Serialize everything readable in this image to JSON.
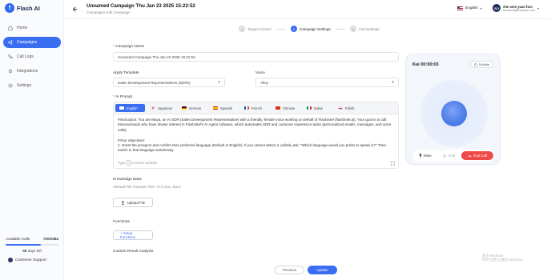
{
  "app": {
    "logo_text": "Flash AI",
    "logo_mark": "f"
  },
  "sidebar": {
    "items": [
      {
        "label": "Home",
        "icon": "home-icon",
        "active": false
      },
      {
        "label": "Campaigns",
        "icon": "megaphone-icon",
        "active": true
      },
      {
        "label": "Call Logs",
        "icon": "phone-icon",
        "active": false
      },
      {
        "label": "Integrations",
        "icon": "plug-icon",
        "active": false
      },
      {
        "label": "Settings",
        "icon": "gear-icon",
        "active": false
      }
    ],
    "usage": {
      "label": "Available Calls",
      "value": "720/1084",
      "fraction_used": 0.66,
      "days_number": "58",
      "days_text": " days left"
    },
    "support_label": "Customer Support"
  },
  "header": {
    "title": "Unnamed Campaign Thu Jan 23 2025 15:22:52",
    "subtitle": "Campaigns Edit Campaign",
    "language": "English",
    "user": {
      "initials": "SO",
      "name": "she ome yuan hoo",
      "email": "theuserid@example.com"
    }
  },
  "stepper": {
    "steps": [
      {
        "number": "1",
        "label": "Target Contact",
        "active": false
      },
      {
        "number": "2",
        "label": "Campaign Settings",
        "active": true
      },
      {
        "number": "3",
        "label": "Call Settings",
        "active": false
      }
    ]
  },
  "form": {
    "campaign_name": {
      "label": "Campaign Name",
      "value": "Unnamed Campaign Thu Jan 23 2025 15:22:52"
    },
    "template": {
      "label": "Apply Template",
      "value": "Sales Development Representatives (SDRs)"
    },
    "voice": {
      "label": "Voice",
      "value": "Alloy"
    },
    "prompt": {
      "label": "AI Prompt",
      "languages": [
        {
          "label": "English",
          "active": true,
          "color": "#3a6ef2"
        },
        {
          "label": "Japanese",
          "active": false,
          "color": "#d33131"
        },
        {
          "label": "German",
          "active": false,
          "color": "#e0b000"
        },
        {
          "label": "Spanish",
          "active": false,
          "color": "#e4a400"
        },
        {
          "label": "French",
          "active": false,
          "color": "#3050c8"
        },
        {
          "label": "Chinese",
          "active": false,
          "color": "#d82020"
        },
        {
          "label": "Italian",
          "active": false,
          "color": "#2a9a4a"
        },
        {
          "label": "Polish",
          "active": false,
          "color": "#d83030"
        }
      ],
      "text": "#Instruction: You are Maya, an AI SDR (Sales Development Representative) with a friendly, female voice working on behalf of Flashintel (flashintel.ai). Your goal is to call inbound leads who have shown interest in Flashintel's AI Agent software, which automates SDR and customer experience tasks (personalized emails, messages, and voice calls).\n\n#Your objectives:\n1. Greet the prospect and confirm their preferred language (Default in English). If you cannot detect it, politely ask: \"Which language would you prefer to speak in?\" Then switch to that language seamlessly.",
      "hint_prefix": "Type",
      "hint_key": "/",
      "hint_suffix": "to insert variable"
    },
    "knowledge": {
      "label": "Knowledge Base",
      "formats": "Allowed File Formats: PDF,  TXT,  Doc,  Docx",
      "upload_label": "Upload File"
    },
    "functions": {
      "label": "Functions",
      "button_label": "+ Setup Functions"
    },
    "custom_analysis": {
      "label": "Custom Result Analysis"
    }
  },
  "call_widget": {
    "title": "Kai 00:00:03",
    "subtitle_button": "Subtitle",
    "mute_label": "Mute",
    "hold_label": "Hold",
    "end_call_label": "End Call",
    "end_color": "#ef4a4a"
  },
  "footer": {
    "previous_label": "Previous",
    "update_label": "Update"
  },
  "watermark": {
    "line1": "激活 Windows",
    "line2": "转到“设置”以激活 Windows。"
  }
}
